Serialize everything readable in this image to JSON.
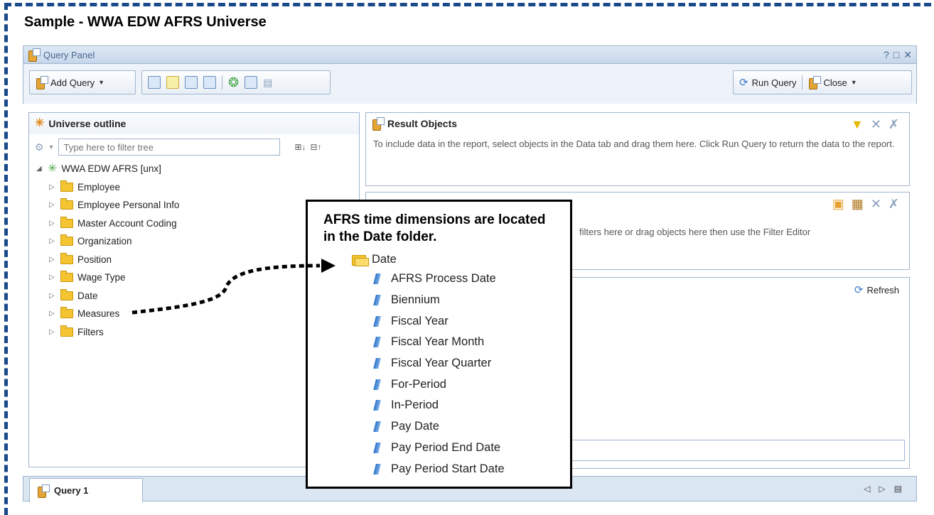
{
  "sample_title": "Sample - WWA EDW AFRS Universe",
  "window": {
    "title": "Query Panel"
  },
  "toolbar": {
    "add_query_label": "Add Query",
    "run_query_label": "Run Query",
    "close_label": "Close"
  },
  "universe_outline": {
    "title": "Universe outline",
    "filter_placeholder": "Type here to filter tree",
    "root": "WWA EDW AFRS [unx]",
    "folders": [
      {
        "label": "Employee"
      },
      {
        "label": "Employee Personal Info"
      },
      {
        "label": "Master Account Coding"
      },
      {
        "label": "Organization"
      },
      {
        "label": "Position"
      },
      {
        "label": "Wage Type"
      },
      {
        "label": "Date"
      },
      {
        "label": "Measures"
      },
      {
        "label": "Filters"
      }
    ]
  },
  "result_objects": {
    "title": "Result Objects",
    "help_text": "To include data in the report, select objects in the Data tab and drag them here. Click Run Query to return the data to the report."
  },
  "query_filters": {
    "help_text_fragment": "filters here or drag objects here then use the Filter Editor"
  },
  "data_preview": {
    "refresh_label": "Refresh"
  },
  "bottom_tab": {
    "label": "Query 1"
  },
  "callout": {
    "text": "AFRS time dimensions are located in the Date folder.",
    "folder": "Date",
    "dimensions": [
      "AFRS Process Date",
      "Biennium",
      "Fiscal Year",
      "Fiscal Year Month",
      "Fiscal Year Quarter",
      "For-Period",
      "In-Period",
      "Pay Date",
      "Pay Period End Date",
      "Pay Period Start Date"
    ]
  }
}
